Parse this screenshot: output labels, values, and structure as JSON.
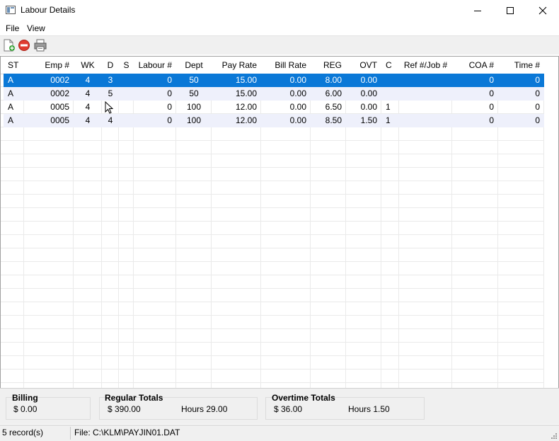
{
  "window": {
    "title": "Labour Details"
  },
  "menu": {
    "file": "File",
    "view": "View"
  },
  "toolbar": {
    "new_icon": "new-document-icon",
    "delete_icon": "delete-icon",
    "print_icon": "print-icon"
  },
  "grid": {
    "headers": [
      "ST",
      "Emp #",
      "WK",
      "D",
      "S",
      "Labour #",
      "Dept",
      "Pay Rate",
      "Bill Rate",
      "REG",
      "OVT",
      "C",
      "Ref #/Job #",
      "COA #",
      "Time #"
    ],
    "rows": [
      {
        "st": "A",
        "emp": "0002",
        "wk": "4",
        "d": "3",
        "s": "",
        "labour": "0",
        "dept": "50",
        "pay_rate": "15.00",
        "bill_rate": "0.00",
        "reg": "8.00",
        "ovt": "0.00",
        "c": "",
        "ref": "",
        "coa": "0",
        "time": "0"
      },
      {
        "st": "A",
        "emp": "0002",
        "wk": "4",
        "d": "5",
        "s": "",
        "labour": "0",
        "dept": "50",
        "pay_rate": "15.00",
        "bill_rate": "0.00",
        "reg": "6.00",
        "ovt": "0.00",
        "c": "",
        "ref": "",
        "coa": "0",
        "time": "0"
      },
      {
        "st": "A",
        "emp": "0005",
        "wk": "4",
        "d": "",
        "s": "",
        "labour": "0",
        "dept": "100",
        "pay_rate": "12.00",
        "bill_rate": "0.00",
        "reg": "6.50",
        "ovt": "0.00",
        "c": "1",
        "ref": "",
        "coa": "0",
        "time": "0"
      },
      {
        "st": "A",
        "emp": "0005",
        "wk": "4",
        "d": "4",
        "s": "",
        "labour": "0",
        "dept": "100",
        "pay_rate": "12.00",
        "bill_rate": "0.00",
        "reg": "8.50",
        "ovt": "1.50",
        "c": "1",
        "ref": "",
        "coa": "0",
        "time": "0"
      }
    ],
    "selected_color": "#0a78d7",
    "alt_row_color": "#eef0fb"
  },
  "totals": {
    "billing": {
      "title": "Billing",
      "amount": "$  0.00"
    },
    "regular": {
      "title": "Regular Totals",
      "amount": "$  390.00",
      "hours": "Hours  29.00"
    },
    "overtime": {
      "title": "Overtime Totals",
      "amount": "$  36.00",
      "hours": "Hours  1.50"
    }
  },
  "status": {
    "records": "5 record(s)",
    "file": "File: C:\\KLM\\PAYJIN01.DAT"
  }
}
